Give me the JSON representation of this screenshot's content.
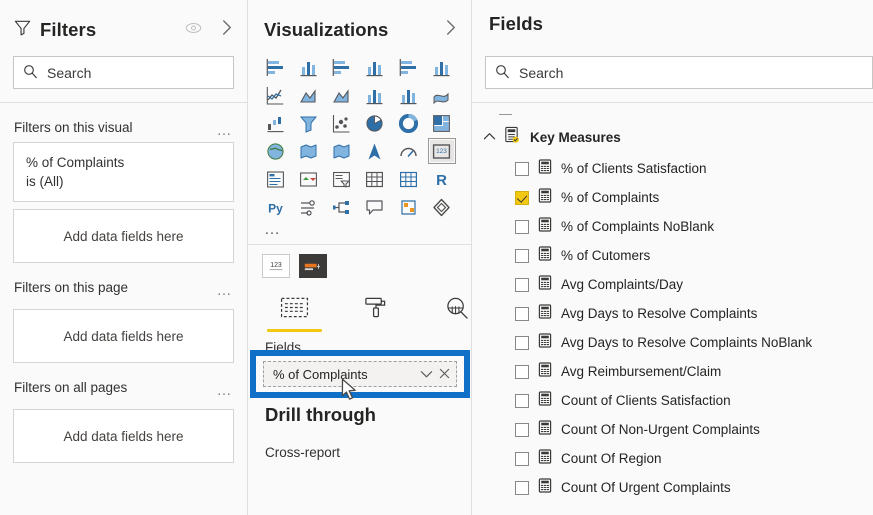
{
  "filters": {
    "title": "Filters",
    "eye_icon": "eye-icon",
    "expand_icon": "chevron-right-icon",
    "search_placeholder": "Search",
    "search_icon": "search-icon",
    "groups": [
      {
        "label": "Filters on this visual",
        "menu": "…",
        "cards": [
          {
            "field": "% of Complaints",
            "condition": "is (All)"
          }
        ],
        "dropzone": "Add data fields here"
      },
      {
        "label": "Filters on this page",
        "menu": "…",
        "cards": [],
        "dropzone": "Add data fields here"
      },
      {
        "label": "Filters on all pages",
        "menu": "…",
        "cards": [],
        "dropzone": "Add data fields here"
      }
    ]
  },
  "visualizations": {
    "title": "Visualizations",
    "expand_icon": "chevron-right-icon",
    "more_icon": "…",
    "selected_index": 23,
    "icons": [
      "stacked-bar-chart-icon",
      "stacked-column-chart-icon",
      "clustered-bar-chart-icon",
      "clustered-column-chart-icon",
      "100-stacked-bar-chart-icon",
      "100-stacked-column-chart-icon",
      "line-chart-icon",
      "area-chart-icon",
      "stacked-area-chart-icon",
      "line-and-stacked-column-chart-icon",
      "line-and-clustered-column-chart-icon",
      "ribbon-chart-icon",
      "waterfall-chart-icon",
      "funnel-chart-icon",
      "scatter-chart-icon",
      "pie-chart-icon",
      "donut-chart-icon",
      "treemap-icon",
      "map-icon",
      "filled-map-icon",
      "shape-map-icon",
      "azure-map-icon",
      "gauge-icon",
      "card-icon",
      "multi-row-card-icon",
      "kpi-icon",
      "slicer-icon",
      "table-icon",
      "matrix-icon",
      "r-script-visual-icon",
      "python-visual-icon",
      "key-influencers-icon",
      "decomposition-tree-icon",
      "smart-narrative-icon",
      "paginated-report-icon",
      "power-apps-icon"
    ],
    "selected_visual_icons": [
      "card-123-icon",
      "format-selected-thumb-icon"
    ],
    "tabs": [
      {
        "label": "Fields",
        "icon": "fields-tab-icon",
        "selected": true
      },
      {
        "label": "Format",
        "icon": "paint-roller-icon",
        "selected": false
      },
      {
        "label": "Analytics",
        "icon": "magnifier-chart-icon",
        "selected": false
      }
    ],
    "wells_label": "Fields",
    "well_pill": {
      "name": "% of Complaints",
      "chevron_icon": "chevron-down-icon",
      "remove_icon": "close-x-icon"
    },
    "drill_through_title": "Drill through",
    "cross_report_label": "Cross-report"
  },
  "fields": {
    "title": "Fields",
    "search_placeholder": "Search",
    "search_icon": "search-icon",
    "collapse_icon": "collapse-dash-icon",
    "table": {
      "name": "Key Measures",
      "expand_icon": "chevron-up-icon",
      "table_icon": "measures-table-icon",
      "items": [
        {
          "label": "% of Clients Satisfaction",
          "checked": false,
          "icon": "measure-icon"
        },
        {
          "label": "% of Complaints",
          "checked": true,
          "icon": "measure-icon"
        },
        {
          "label": "% of Complaints NoBlank",
          "checked": false,
          "icon": "measure-icon"
        },
        {
          "label": "% of Cutomers",
          "checked": false,
          "icon": "measure-icon"
        },
        {
          "label": "Avg Complaints/Day",
          "checked": false,
          "icon": "measure-icon"
        },
        {
          "label": "Avg Days to Resolve Complaints",
          "checked": false,
          "icon": "measure-icon"
        },
        {
          "label": "Avg Days to Resolve Complaints NoBlank",
          "checked": false,
          "icon": "measure-icon"
        },
        {
          "label": "Avg Reimbursement/Claim",
          "checked": false,
          "icon": "measure-icon"
        },
        {
          "label": "Count of Clients Satisfaction",
          "checked": false,
          "icon": "measure-icon"
        },
        {
          "label": "Count Of Non-Urgent Complaints",
          "checked": false,
          "icon": "measure-icon"
        },
        {
          "label": "Count Of Region",
          "checked": false,
          "icon": "measure-icon"
        },
        {
          "label": "Count Of Urgent Complaints",
          "checked": false,
          "icon": "measure-icon"
        }
      ]
    }
  },
  "annotation": {
    "color": "#1070c8",
    "target": "% of Complaints"
  }
}
